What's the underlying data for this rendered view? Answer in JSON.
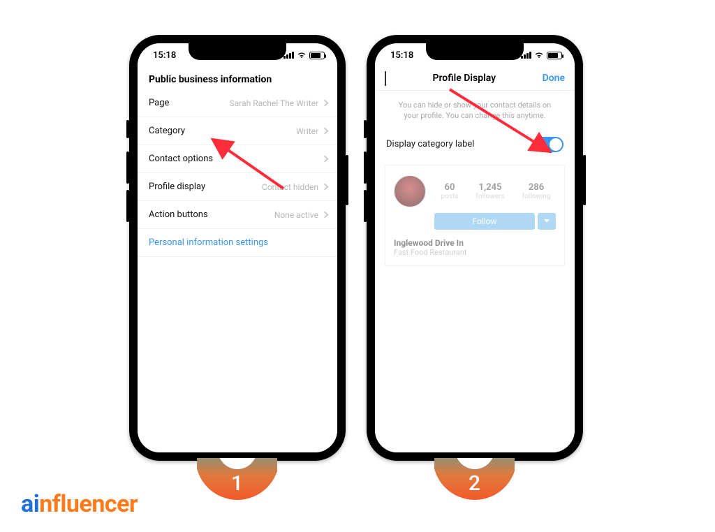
{
  "status": {
    "time": "15:18"
  },
  "left": {
    "section_title": "Public business information",
    "rows": {
      "page": {
        "label": "Page",
        "value": "Sarah Rachel The Writer"
      },
      "category": {
        "label": "Category",
        "value": "Writer"
      },
      "contact": {
        "label": "Contact options",
        "value": ""
      },
      "profile": {
        "label": "Profile display",
        "value": "Contact hidden"
      },
      "action": {
        "label": "Action buttons",
        "value": "None active"
      }
    },
    "personal_link": "Personal information settings"
  },
  "right": {
    "nav_title": "Profile Display",
    "done": "Done",
    "hint": "You can hide or show your contact details on your profile. You can change this anytime.",
    "toggle_label": "Display category label",
    "stats": {
      "posts": {
        "num": "60",
        "label": "posts"
      },
      "followers": {
        "num": "1,245",
        "label": "followers"
      },
      "following": {
        "num": "286",
        "label": "following"
      }
    },
    "follow_label": "Follow",
    "business_name": "Inglewood Drive In",
    "business_category": "Fast Food Restaurant"
  },
  "steps": {
    "one": "1",
    "two": "2"
  },
  "logo": {
    "a": "a",
    "i": "i",
    "rest": "nfluencer"
  }
}
